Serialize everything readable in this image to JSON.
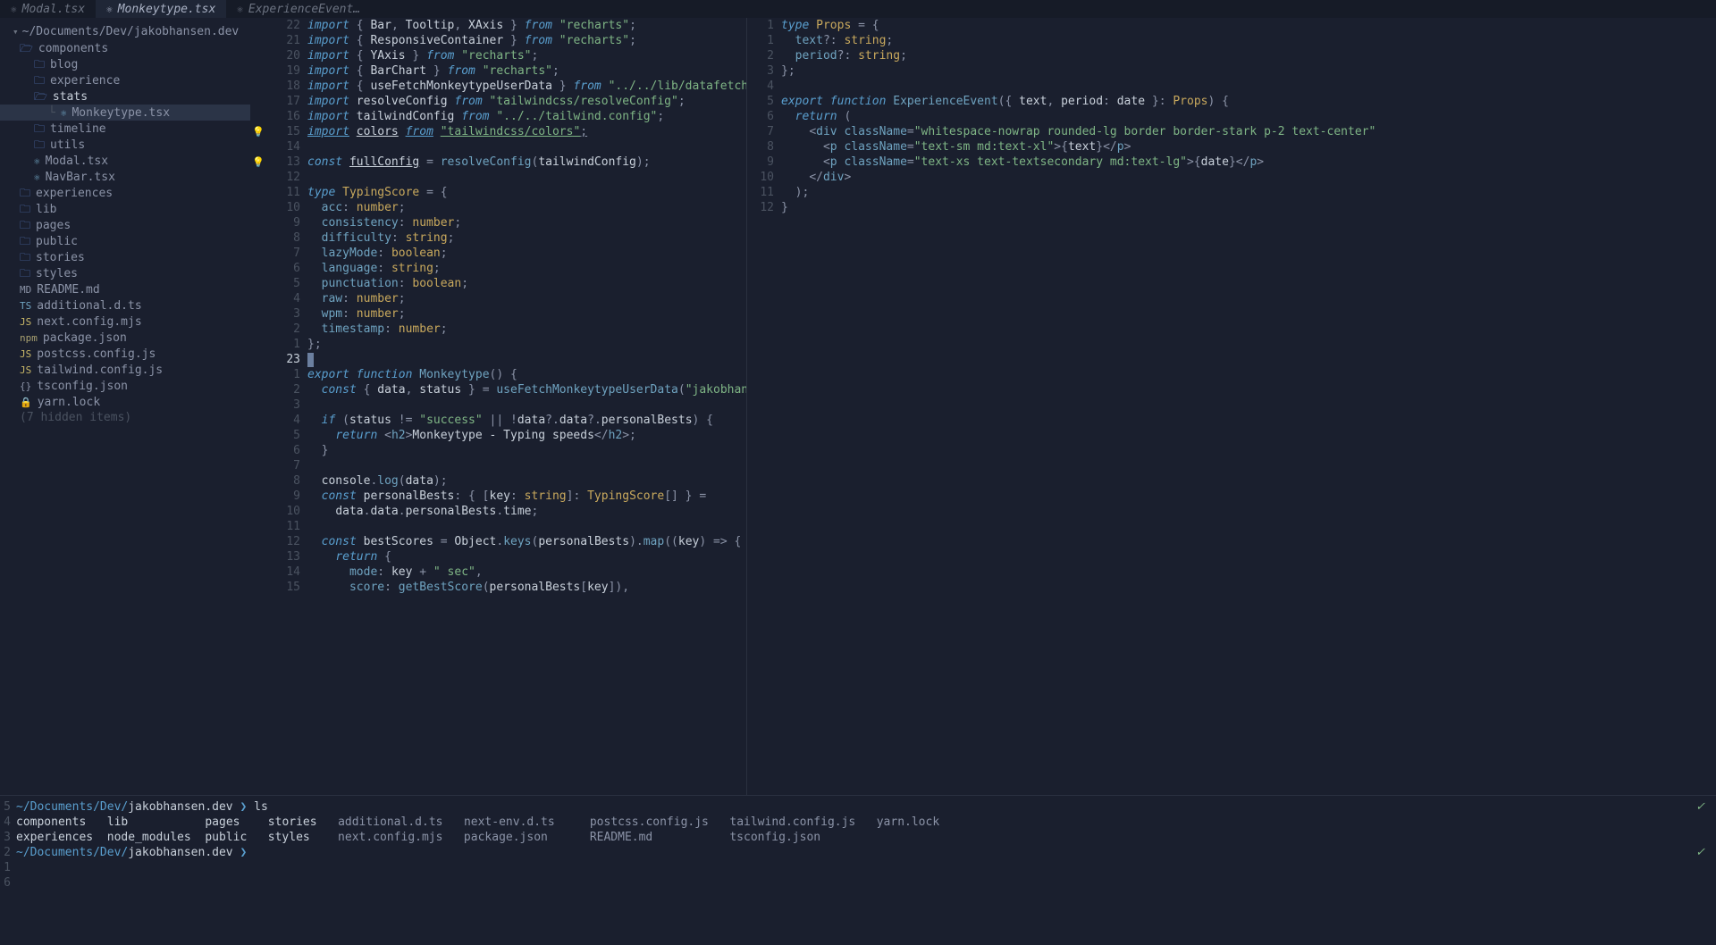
{
  "tabs": [
    {
      "icon": "⚛",
      "label": "Modal.tsx",
      "active": false
    },
    {
      "icon": "⚛",
      "label": "Monkeytype.tsx",
      "active": true
    },
    {
      "icon": "⚛",
      "label": "ExperienceEvent…",
      "active": false
    }
  ],
  "tree": {
    "root": "~/Documents/Dev/jakobhansen.dev",
    "items": [
      {
        "type": "folder-open",
        "label": "components",
        "indent": 0
      },
      {
        "type": "folder",
        "label": "blog",
        "indent": 1
      },
      {
        "type": "folder",
        "label": "experience",
        "indent": 1
      },
      {
        "type": "folder-open",
        "label": "stats",
        "indent": 1,
        "highlighted": true
      },
      {
        "type": "file",
        "icon": "ts",
        "iconText": "⚛",
        "label": "Monkeytype.tsx",
        "indent": 3,
        "selected": true,
        "prefix": "└ "
      },
      {
        "type": "folder",
        "label": "timeline",
        "indent": 1
      },
      {
        "type": "folder",
        "label": "utils",
        "indent": 1
      },
      {
        "type": "file",
        "icon": "ts",
        "iconText": "⚛",
        "label": "Modal.tsx",
        "indent": 1
      },
      {
        "type": "file",
        "icon": "ts",
        "iconText": "⚛",
        "label": "NavBar.tsx",
        "indent": 1
      },
      {
        "type": "folder",
        "label": "experiences",
        "indent": 0
      },
      {
        "type": "folder",
        "label": "lib",
        "indent": 0
      },
      {
        "type": "folder",
        "label": "pages",
        "indent": 0
      },
      {
        "type": "folder",
        "label": "public",
        "indent": 0
      },
      {
        "type": "folder",
        "label": "stories",
        "indent": 0
      },
      {
        "type": "folder",
        "label": "styles",
        "indent": 0
      },
      {
        "type": "file",
        "icon": "md",
        "iconText": "MD",
        "label": "README.md",
        "indent": 0
      },
      {
        "type": "file",
        "icon": "ts",
        "iconText": "TS",
        "label": "additional.d.ts",
        "indent": 0
      },
      {
        "type": "file",
        "icon": "js",
        "iconText": "JS",
        "label": "next.config.mjs",
        "indent": 0
      },
      {
        "type": "file",
        "icon": "json",
        "iconText": "npm",
        "label": "package.json",
        "indent": 0
      },
      {
        "type": "file",
        "icon": "js",
        "iconText": "JS",
        "label": "postcss.config.js",
        "indent": 0
      },
      {
        "type": "file",
        "icon": "js",
        "iconText": "JS",
        "label": "tailwind.config.js",
        "indent": 0
      },
      {
        "type": "file",
        "icon": "conf",
        "iconText": "{}",
        "label": "tsconfig.json",
        "indent": 0
      },
      {
        "type": "file",
        "icon": "lock",
        "iconText": "🔒",
        "label": "yarn.lock",
        "indent": 0
      }
    ],
    "hidden": "(7 hidden items)"
  },
  "editor_left": {
    "lines": [
      {
        "ln": "22",
        "sign": "",
        "html": "<span class='kw'>import</span> <span class='punc'>{</span> <span class='ident'>Bar</span><span class='punc'>,</span> <span class='ident'>Tooltip</span><span class='punc'>,</span> <span class='ident'>XAxis</span> <span class='punc'>}</span> <span class='kw'>from</span> <span class='str'>\"recharts\"</span><span class='punc'>;</span>"
      },
      {
        "ln": "21",
        "sign": "",
        "html": "<span class='kw'>import</span> <span class='punc'>{</span> <span class='ident'>ResponsiveContainer</span> <span class='punc'>}</span> <span class='kw'>from</span> <span class='str'>\"recharts\"</span><span class='punc'>;</span>"
      },
      {
        "ln": "20",
        "sign": "",
        "html": "<span class='kw'>import</span> <span class='punc'>{</span> <span class='ident'>YAxis</span> <span class='punc'>}</span> <span class='kw'>from</span> <span class='str'>\"recharts\"</span><span class='punc'>;</span>"
      },
      {
        "ln": "19",
        "sign": "",
        "html": "<span class='kw'>import</span> <span class='punc'>{</span> <span class='ident'>BarChart</span> <span class='punc'>}</span> <span class='kw'>from</span> <span class='str'>\"recharts\"</span><span class='punc'>;</span>"
      },
      {
        "ln": "18",
        "sign": "",
        "html": "<span class='kw'>import</span> <span class='punc'>{</span> <span class='ident'>useFetchMonkeytypeUserData</span> <span class='punc'>}</span> <span class='kw'>from</span> <span class='str'>\"../../lib/datafetching/monkeyt</span>"
      },
      {
        "ln": "17",
        "sign": "",
        "html": "<span class='kw'>import</span> <span class='ident'>resolveConfig</span> <span class='kw'>from</span> <span class='str'>\"tailwindcss/resolveConfig\"</span><span class='punc'>;</span>"
      },
      {
        "ln": "16",
        "sign": "",
        "html": "<span class='kw'>import</span> <span class='ident'>tailwindConfig</span> <span class='kw'>from</span> <span class='str'>\"../../tailwind.config\"</span><span class='punc'>;</span>"
      },
      {
        "ln": "15",
        "sign": "💡",
        "html": "<span class='kw underline'>import</span> <span class='ident underline'>colors</span> <span class='kw underline'>from</span> <span class='str underline'>\"tailwindcss/colors\"</span><span class='punc underline'>;</span>"
      },
      {
        "ln": "14",
        "sign": "",
        "html": ""
      },
      {
        "ln": "13",
        "sign": "💡",
        "html": "<span class='kw'>const</span> <span class='ident underline'>fullConfig</span> <span class='punc'>=</span> <span class='fn'>resolveConfig</span><span class='punc'>(</span><span class='ident'>tailwindConfig</span><span class='punc'>);</span>"
      },
      {
        "ln": "12",
        "sign": "",
        "html": ""
      },
      {
        "ln": "11",
        "sign": "",
        "html": "<span class='kw'>type</span> <span class='type'>TypingScore</span> <span class='punc'>=</span> <span class='punc'>{</span>"
      },
      {
        "ln": "10",
        "sign": "",
        "html": "  <span class='prop'>acc</span><span class='punc'>:</span> <span class='type'>number</span><span class='punc'>;</span>"
      },
      {
        "ln": "9",
        "sign": "",
        "html": "  <span class='prop'>consistency</span><span class='punc'>:</span> <span class='type'>number</span><span class='punc'>;</span>"
      },
      {
        "ln": "8",
        "sign": "",
        "html": "  <span class='prop'>difficulty</span><span class='punc'>:</span> <span class='type'>string</span><span class='punc'>;</span>"
      },
      {
        "ln": "7",
        "sign": "",
        "html": "  <span class='prop'>lazyMode</span><span class='punc'>:</span> <span class='type'>boolean</span><span class='punc'>;</span>"
      },
      {
        "ln": "6",
        "sign": "",
        "html": "  <span class='prop'>language</span><span class='punc'>:</span> <span class='type'>string</span><span class='punc'>;</span>"
      },
      {
        "ln": "5",
        "sign": "",
        "html": "  <span class='prop'>punctuation</span><span class='punc'>:</span> <span class='type'>boolean</span><span class='punc'>;</span>"
      },
      {
        "ln": "4",
        "sign": "",
        "html": "  <span class='prop'>raw</span><span class='punc'>:</span> <span class='type'>number</span><span class='punc'>;</span>"
      },
      {
        "ln": "3",
        "sign": "",
        "html": "  <span class='prop'>wpm</span><span class='punc'>:</span> <span class='type'>number</span><span class='punc'>;</span>"
      },
      {
        "ln": "2",
        "sign": "",
        "html": "  <span class='prop'>timestamp</span><span class='punc'>:</span> <span class='type'>number</span><span class='punc'>;</span>"
      },
      {
        "ln": "1",
        "sign": "",
        "html": "<span class='punc'>};</span>"
      },
      {
        "ln": "23",
        "sign": "",
        "html": "<span class='cursor'></span>",
        "current": true
      },
      {
        "ln": "1",
        "sign": "",
        "html": "<span class='kw'>export</span> <span class='kw'>function</span> <span class='fn'>Monkeytype</span><span class='punc'>() {</span>"
      },
      {
        "ln": "2",
        "sign": "",
        "html": "  <span class='kw'>const</span> <span class='punc'>{</span> <span class='ident'>data</span><span class='punc'>,</span> <span class='ident'>status</span> <span class='punc'>}</span> <span class='punc'>=</span> <span class='fn'>useFetchMonkeytypeUserData</span><span class='punc'>(</span><span class='str'>\"jakobhansen\"</span><span class='punc'>);</span>"
      },
      {
        "ln": "3",
        "sign": "",
        "html": ""
      },
      {
        "ln": "4",
        "sign": "",
        "html": "  <span class='kw'>if</span> <span class='punc'>(</span><span class='ident'>status</span> <span class='punc'>!=</span> <span class='str'>\"success\"</span> <span class='punc'>||</span> <span class='punc'>!</span><span class='ident'>data</span><span class='punc'>?.</span><span class='ident'>data</span><span class='punc'>?.</span><span class='ident'>personalBests</span><span class='punc'>) {</span>"
      },
      {
        "ln": "5",
        "sign": "",
        "html": "    <span class='kw'>return</span> <span class='punc'>&lt;</span><span class='tag'>h2</span><span class='punc'>&gt;</span><span class='ident'>Monkeytype - Typing speeds</span><span class='punc'>&lt;/</span><span class='tag'>h2</span><span class='punc'>&gt;;</span>"
      },
      {
        "ln": "6",
        "sign": "",
        "html": "  <span class='punc'>}</span>"
      },
      {
        "ln": "7",
        "sign": "",
        "html": ""
      },
      {
        "ln": "8",
        "sign": "",
        "html": "  <span class='ident'>console</span><span class='punc'>.</span><span class='fn'>log</span><span class='punc'>(</span><span class='ident'>data</span><span class='punc'>);</span>"
      },
      {
        "ln": "9",
        "sign": "",
        "html": "  <span class='kw'>const</span> <span class='ident'>personalBests</span><span class='punc'>: { [</span><span class='ident'>key</span><span class='punc'>:</span> <span class='type'>string</span><span class='punc'>]:</span> <span class='type'>TypingScore</span><span class='punc'>[] } =</span>"
      },
      {
        "ln": "10",
        "sign": "",
        "html": "    <span class='ident'>data</span><span class='punc'>.</span><span class='ident'>data</span><span class='punc'>.</span><span class='ident'>personalBests</span><span class='punc'>.</span><span class='ident'>time</span><span class='punc'>;</span>"
      },
      {
        "ln": "11",
        "sign": "",
        "html": ""
      },
      {
        "ln": "12",
        "sign": "",
        "html": "  <span class='kw'>const</span> <span class='ident'>bestScores</span> <span class='punc'>=</span> <span class='ident'>Object</span><span class='punc'>.</span><span class='fn'>keys</span><span class='punc'>(</span><span class='ident'>personalBests</span><span class='punc'>).</span><span class='fn'>map</span><span class='punc'>((</span><span class='ident'>key</span><span class='punc'>) =&gt; {</span>"
      },
      {
        "ln": "13",
        "sign": "",
        "html": "    <span class='kw'>return</span> <span class='punc'>{</span>"
      },
      {
        "ln": "14",
        "sign": "",
        "html": "      <span class='prop'>mode</span><span class='punc'>:</span> <span class='ident'>key</span> <span class='punc'>+</span> <span class='str'>\" sec\"</span><span class='punc'>,</span>"
      },
      {
        "ln": "15",
        "sign": "",
        "html": "      <span class='prop'>score</span><span class='punc'>:</span> <span class='fn'>getBestScore</span><span class='punc'>(</span><span class='ident'>personalBests</span><span class='punc'>[</span><span class='ident'>key</span><span class='punc'>]),</span>"
      }
    ]
  },
  "editor_right": {
    "lines": [
      {
        "ln": "1",
        "html": "<span class='kw'>type</span> <span class='type'>Props</span> <span class='punc'>=</span> <span class='punc'>{</span>"
      },
      {
        "ln": "1",
        "html": "  <span class='prop'>text</span><span class='punc'>?:</span> <span class='type'>string</span><span class='punc'>;</span>"
      },
      {
        "ln": "2",
        "html": "  <span class='prop'>period</span><span class='punc'>?:</span> <span class='type'>string</span><span class='punc'>;</span>"
      },
      {
        "ln": "3",
        "html": "<span class='punc'>};</span>"
      },
      {
        "ln": "4",
        "html": ""
      },
      {
        "ln": "5",
        "html": "<span class='kw'>export</span> <span class='kw'>function</span> <span class='fn'>ExperienceEvent</span><span class='punc'>({</span> <span class='ident'>text</span><span class='punc'>,</span> <span class='ident'>period</span><span class='punc'>:</span> <span class='ident'>date</span> <span class='punc'>}:</span> <span class='type'>Props</span><span class='punc'>) {</span>"
      },
      {
        "ln": "6",
        "html": "  <span class='kw'>return</span> <span class='punc'>(</span>"
      },
      {
        "ln": "7",
        "html": "    <span class='punc'>&lt;</span><span class='tag'>div</span> <span class='prop'>className</span><span class='punc'>=</span><span class='str'>\"whitespace-nowrap rounded-lg border border-stark p-2 text-center\"</span>"
      },
      {
        "ln": "8",
        "html": "      <span class='punc'>&lt;</span><span class='tag'>p</span> <span class='prop'>className</span><span class='punc'>=</span><span class='str'>\"text-sm md:text-xl\"</span><span class='punc'>&gt;{</span><span class='ident'>text</span><span class='punc'>}&lt;/</span><span class='tag'>p</span><span class='punc'>&gt;</span>"
      },
      {
        "ln": "9",
        "html": "      <span class='punc'>&lt;</span><span class='tag'>p</span> <span class='prop'>className</span><span class='punc'>=</span><span class='str'>\"text-xs text-textsecondary md:text-lg\"</span><span class='punc'>&gt;{</span><span class='ident'>date</span><span class='punc'>}&lt;/</span><span class='tag'>p</span><span class='punc'>&gt;</span>"
      },
      {
        "ln": "10",
        "html": "    <span class='punc'>&lt;/</span><span class='tag'>div</span><span class='punc'>&gt;</span>"
      },
      {
        "ln": "11",
        "html": "  <span class='punc'>);</span>"
      },
      {
        "ln": "12",
        "html": "<span class='punc'>}</span>"
      }
    ]
  },
  "terminal": {
    "rows": [
      {
        "ln": "5",
        "content": "<span class='term-prompt'>~/Documents/Dev/</span><span class='term-path'>jakobhansen.dev</span> <span class='term-prompt'>❯</span> <span class='term-text'>ls</span>",
        "check": true
      },
      {
        "ln": "4",
        "content": "<span class='term-files'><span class='f'>components</span>   <span class='f'>lib</span>           <span class='f'>pages</span>    <span class='f'>stories</span>   additional.d.ts   next-env.d.ts     postcss.config.js   tailwind.config.js   yarn.lock</span>"
      },
      {
        "ln": "3",
        "content": "<span class='term-files'><span class='f'>experiences</span>  <span class='f'>node_modules</span>  <span class='f'>public</span>   <span class='f'>styles</span>    next.config.mjs   package.json      README.md           tsconfig.json</span>"
      },
      {
        "ln": "2",
        "content": "<span class='term-prompt'>~/Documents/Dev/</span><span class='term-path'>jakobhansen.dev</span> <span class='term-prompt'>❯</span>",
        "check": true
      },
      {
        "ln": "1",
        "content": ""
      },
      {
        "ln": "6",
        "content": ""
      }
    ]
  }
}
